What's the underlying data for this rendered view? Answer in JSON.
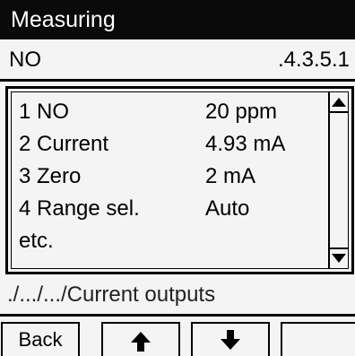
{
  "header": {
    "title": "Measuring"
  },
  "subheader": {
    "name": "NO",
    "code": ".4.3.5.1"
  },
  "list": {
    "rows": [
      {
        "label": "1 NO",
        "value": "20 ppm"
      },
      {
        "label": "2 Current",
        "value": "4.93 mA"
      },
      {
        "label": "3 Zero",
        "value": "2 mA"
      },
      {
        "label": "4 Range sel.",
        "value": "Auto"
      },
      {
        "label": "etc.",
        "value": ""
      }
    ]
  },
  "path": "./.../.../Current outputs",
  "softkeys": {
    "key1_label": "Back",
    "key2_icon": "arrow-up-icon",
    "key3_icon": "arrow-down-icon",
    "key4_label": ""
  }
}
